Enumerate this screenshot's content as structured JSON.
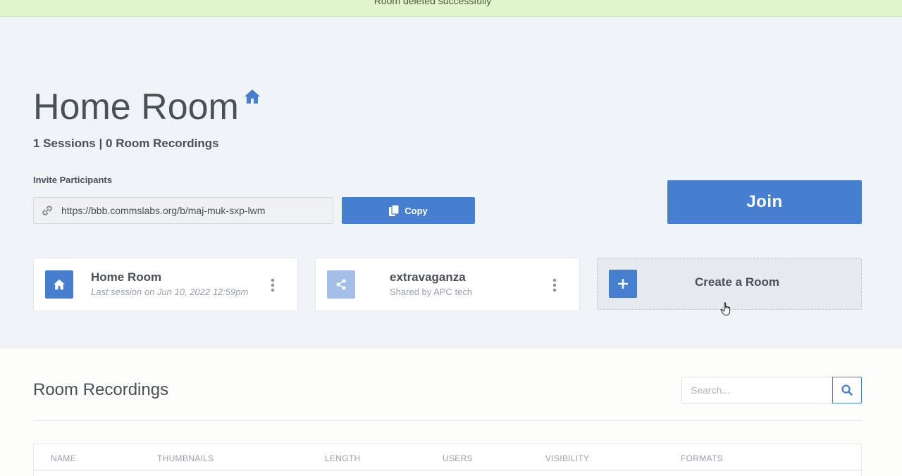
{
  "flash": {
    "message": "Room deleted successfully"
  },
  "room": {
    "title": "Home Room",
    "stats": "1 Sessions | 0 Room Recordings"
  },
  "invite": {
    "label": "Invite Participants",
    "url": "https://bbb.commslabs.org/b/maj-muk-sxp-lwm",
    "copy_label": "Copy"
  },
  "join_label": "Join",
  "rooms": [
    {
      "name": "Home Room",
      "subtitle": "Last session on Jun 10, 2022 12:59pm",
      "icon": "home-icon"
    },
    {
      "name": "extravaganza",
      "subtitle": "Shared by APC tech",
      "icon": "share-icon"
    }
  ],
  "create_room_label": "Create a Room",
  "recordings": {
    "title": "Room Recordings",
    "search_placeholder": "Search...",
    "columns": [
      "NAME",
      "THUMBNAILS",
      "LENGTH",
      "USERS",
      "VISIBILITY",
      "FORMATS"
    ]
  },
  "colors": {
    "accent": "#467fcf",
    "flash_bg": "#e1f5cd",
    "hero_bg": "#f1f4f7"
  }
}
